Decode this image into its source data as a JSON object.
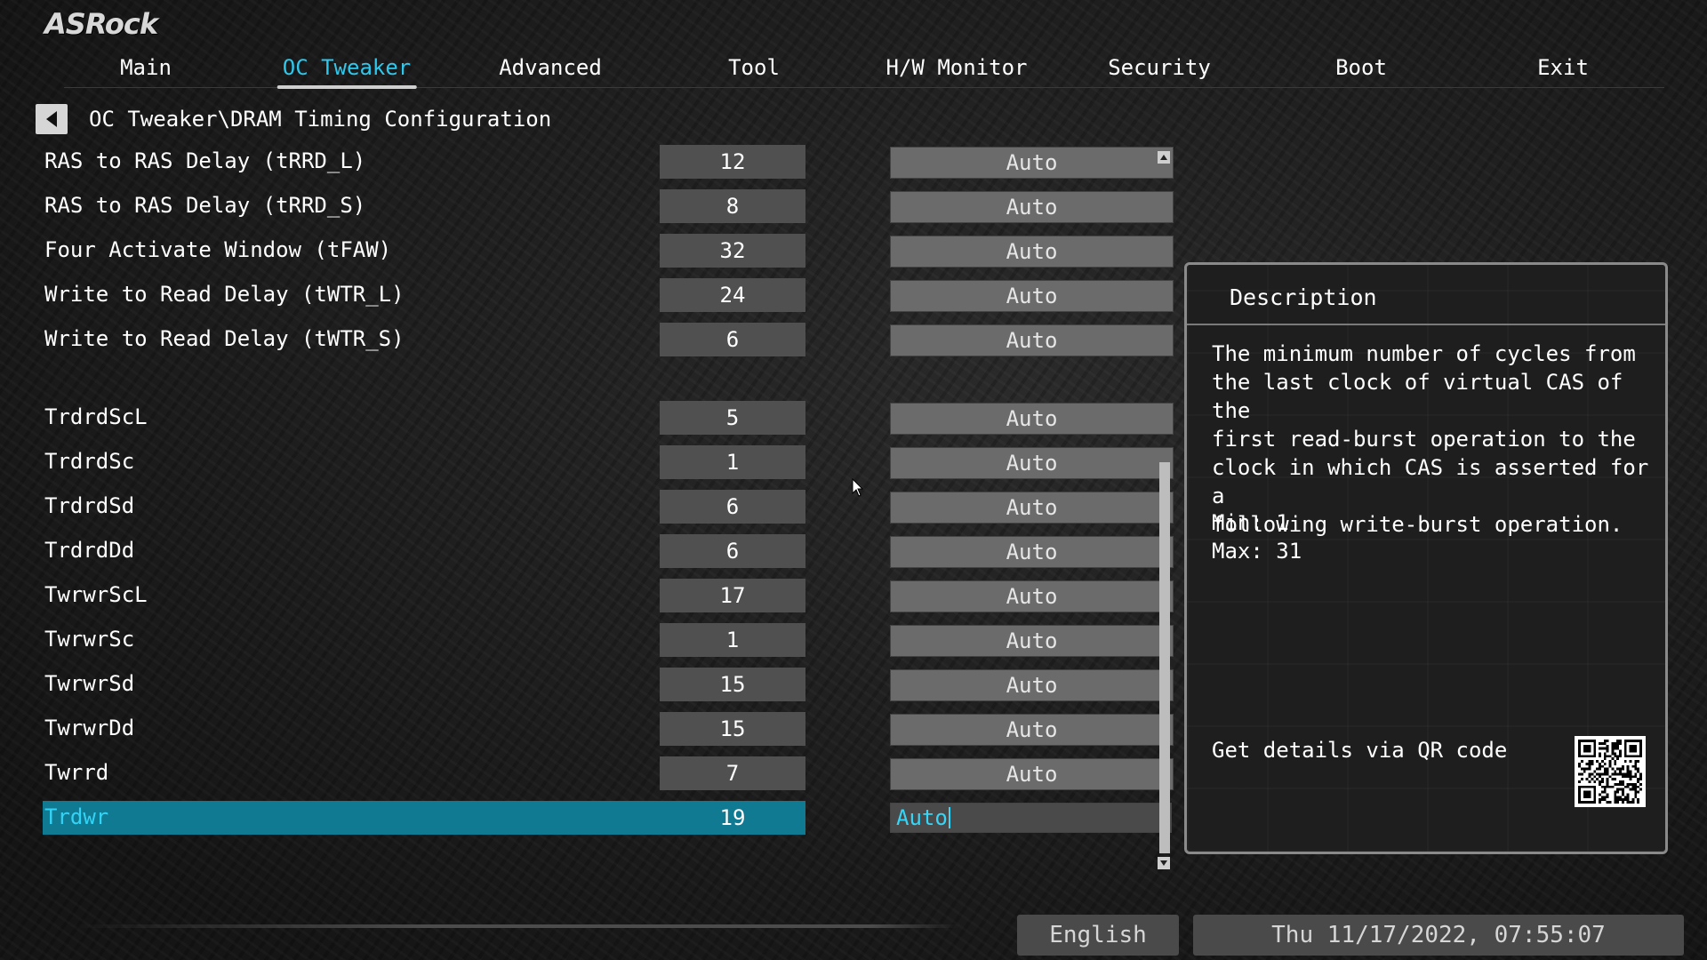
{
  "brand": "ASRock",
  "nav": {
    "tabs": [
      {
        "label": "Main",
        "active": false
      },
      {
        "label": "OC Tweaker",
        "active": true
      },
      {
        "label": "Advanced",
        "active": false
      },
      {
        "label": "Tool",
        "active": false
      },
      {
        "label": "H/W Monitor",
        "active": false
      },
      {
        "label": "Security",
        "active": false
      },
      {
        "label": "Boot",
        "active": false
      },
      {
        "label": "Exit",
        "active": false
      }
    ]
  },
  "breadcrumb": "OC Tweaker\\DRAM Timing Configuration",
  "settings": [
    {
      "label": "RAS to RAS Delay (tRRD_L)",
      "value": "12",
      "option": "Auto"
    },
    {
      "label": "RAS to RAS Delay (tRRD_S)",
      "value": "8",
      "option": "Auto"
    },
    {
      "label": "Four Activate Window (tFAW)",
      "value": "32",
      "option": "Auto"
    },
    {
      "label": "Write to Read Delay (tWTR_L)",
      "value": "24",
      "option": "Auto"
    },
    {
      "label": "Write to Read Delay (tWTR_S)",
      "value": "6",
      "option": "Auto"
    },
    {
      "label": "TrdrdScL",
      "value": "5",
      "option": "Auto"
    },
    {
      "label": "TrdrdSc",
      "value": "1",
      "option": "Auto"
    },
    {
      "label": "TrdrdSd",
      "value": "6",
      "option": "Auto"
    },
    {
      "label": "TrdrdDd",
      "value": "6",
      "option": "Auto"
    },
    {
      "label": "TwrwrScL",
      "value": "17",
      "option": "Auto"
    },
    {
      "label": "TwrwrSc",
      "value": "1",
      "option": "Auto"
    },
    {
      "label": "TwrwrSd",
      "value": "15",
      "option": "Auto"
    },
    {
      "label": "TwrwrDd",
      "value": "15",
      "option": "Auto"
    },
    {
      "label": "Twrrd",
      "value": "7",
      "option": "Auto"
    },
    {
      "label": "Trdwr",
      "value": "19",
      "option": "Auto",
      "selected": true
    }
  ],
  "description": {
    "title": "Description",
    "text": "The minimum number of cycles from\nthe last clock of virtual CAS of the\nfirst read-burst operation to the\nclock in which CAS is asserted for a\nfollowing write-burst operation.",
    "min": "Min: 1",
    "max": "Max: 31",
    "qr_label": "Get details via QR code"
  },
  "footer": {
    "language": "English",
    "datetime": "Thu 11/17/2022, 07:55:07"
  },
  "colors": {
    "accent": "#2fc8ec",
    "selected_row": "#117a93"
  }
}
